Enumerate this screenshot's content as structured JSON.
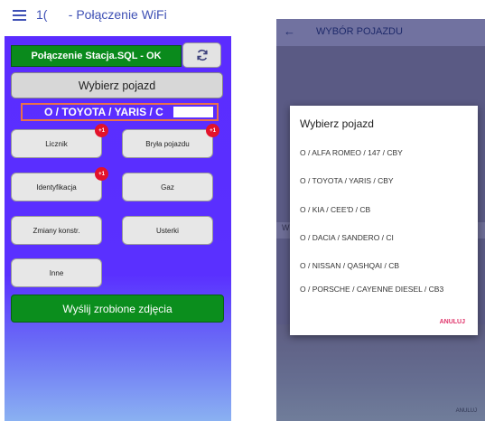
{
  "left_phone": {
    "header": {
      "menu_icon": "hamburger-icon",
      "number": "1(",
      "title": "- Połączenie WiFi"
    },
    "status_button": "Połączenie Stacja.SQL - OK",
    "refresh_icon": "refresh-icon",
    "select_vehicle_button": "Wybierz pojazd",
    "current_vehicle": "O / TOYOTA / YARIS / C",
    "tiles": [
      {
        "label": "Licznik",
        "badge": "+1"
      },
      {
        "label": "Bryła pojazdu",
        "badge": "+1"
      },
      {
        "label": "Identyfikacja",
        "badge": "+1"
      },
      {
        "label": "Gaz",
        "badge": ""
      },
      {
        "label": "Zmiany konstr.",
        "badge": ""
      },
      {
        "label": "Usterki",
        "badge": ""
      },
      {
        "label": "Inne",
        "badge": ""
      }
    ],
    "send_button": "Wyślij zrobione zdjęcia"
  },
  "right_phone": {
    "header": {
      "back_icon": "back-arrow-icon",
      "title": "WYBÓR POJAZDU"
    },
    "background_letter": "W",
    "bottom_text": "ANULUJ",
    "dialog": {
      "title": "Wybierz pojazd",
      "options": [
        "O / ALFA ROMEO / 147 / CBY",
        "O / TOYOTA / YARIS / CBY",
        "O / KIA / CEE'D / CB",
        "O / DACIA / SANDERO / CI",
        "O / NISSAN / QASHQAI / CB",
        "O / PORSCHE / CAYENNE DIESEL / CB3"
      ],
      "cancel": "ANULUJ"
    }
  },
  "colors": {
    "panel_purple": "#5b2cff",
    "green_button": "#0b8e1d",
    "badge_red": "#e3132b",
    "accent_blue": "#3f51b5",
    "cancel_pink": "#e0356b"
  }
}
